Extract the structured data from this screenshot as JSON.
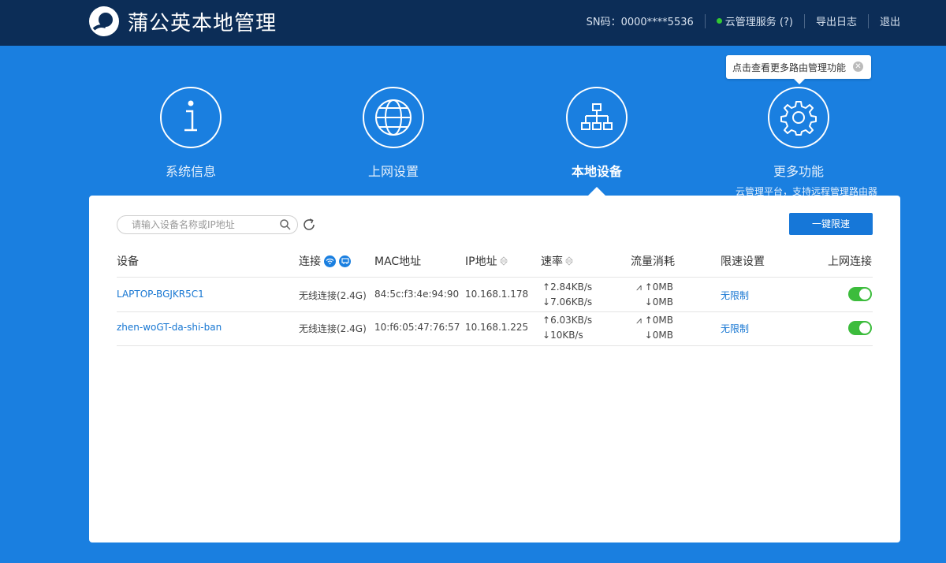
{
  "header": {
    "app_title": "蒲公英本地管理",
    "sn": "SN码：0000****5536",
    "cloud_service": "云管理服务 (?)",
    "export_log": "导出日志",
    "logout": "退出"
  },
  "nav": {
    "items": [
      {
        "label": "系统信息",
        "icon": "info-icon"
      },
      {
        "label": "上网设置",
        "icon": "globe-icon"
      },
      {
        "label": "本地设备",
        "icon": "network-topology-icon",
        "active": true
      },
      {
        "label": "更多功能",
        "icon": "gear-icon",
        "sub": "云管理平台，支持远程管理路由器"
      }
    ],
    "tooltip": "点击查看更多路由管理功能"
  },
  "toolbar": {
    "search_placeholder": "请输入设备名称或IP地址",
    "limit_button": "一键限速"
  },
  "table": {
    "headers": [
      "设备",
      "连接",
      "MAC地址",
      "IP地址",
      "速率",
      "流量消耗",
      "限速设置",
      "上网连接"
    ],
    "rows": [
      {
        "device": "LAPTOP-BGJKR5C1",
        "connection": "无线连接(2.4G)",
        "mac": "84:5c:f3:4e:94:90",
        "ip": "10.168.1.178",
        "speed_up": "2.84KB/s",
        "speed_down": "7.06KB/s",
        "traffic_up": "0MB",
        "traffic_down": "0MB",
        "limit": "无限制",
        "online": true
      },
      {
        "device": "zhen-woGT-da-shi-ban",
        "connection": "无线连接(2.4G)",
        "mac": "10:f6:05:47:76:57",
        "ip": "10.168.1.225",
        "speed_up": "6.03KB/s",
        "speed_down": "10KB/s",
        "traffic_up": "0MB",
        "traffic_down": "0MB",
        "limit": "无限制",
        "online": true
      }
    ]
  },
  "colors": {
    "header_bg": "#0c2d57",
    "page_bg": "#1a7fe0",
    "accent": "#1677d8",
    "toggle_on": "#3cbc3c"
  }
}
